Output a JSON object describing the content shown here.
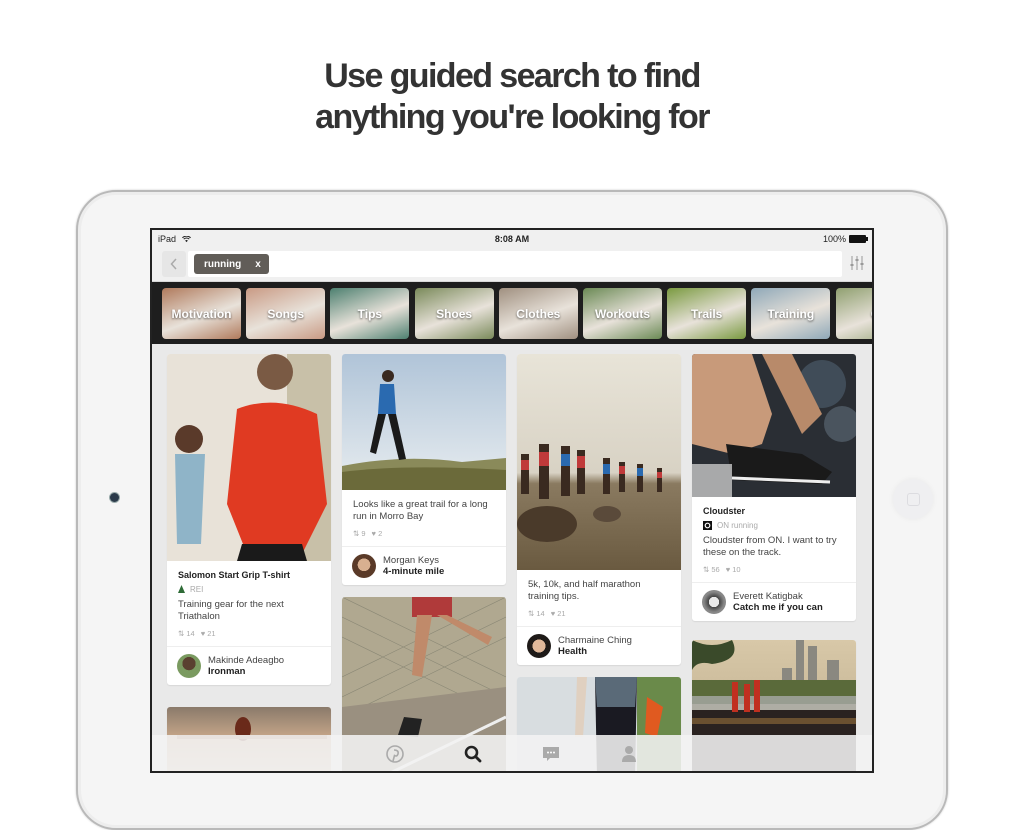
{
  "headline": {
    "line1": "Use guided search to find",
    "line2": "anything you're looking for"
  },
  "device": {
    "status_bar": {
      "device_label": "iPad",
      "wifi_icon": "wifi-icon",
      "time": "8:08 AM",
      "battery_percent": "100%"
    }
  },
  "search": {
    "back_icon": "chevron-left-icon",
    "query_token": "running",
    "clear_token_label": "x",
    "filter_icon": "sliders-icon"
  },
  "guides": [
    {
      "label": "Motivation",
      "color": "#b07a5c"
    },
    {
      "label": "Songs",
      "color": "#c99a84"
    },
    {
      "label": "Tips",
      "color": "#4d8070"
    },
    {
      "label": "Shoes",
      "color": "#7a8a5a"
    },
    {
      "label": "Clothes",
      "color": "#a09080"
    },
    {
      "label": "Workouts",
      "color": "#6b8a55"
    },
    {
      "label": "Trails",
      "color": "#7a9a40"
    },
    {
      "label": "Training",
      "color": "#8fa8b8"
    },
    {
      "label": "C",
      "color": "#90a070"
    }
  ],
  "pins": [
    {
      "title": "Salomon Start Grip T-shirt",
      "source": "REI",
      "source_icon": "tree-icon",
      "description": "Training gear for the next Triathalon",
      "repins": "14",
      "likes": "21",
      "pinner_name": "Makinde Adeagbo",
      "board": "Ironman",
      "photo_color": "#d9d0c4",
      "accent_color": "#e03a22"
    },
    {
      "title": "",
      "source": "",
      "description": "Looks like a great trail for a long run in Morro Bay",
      "repins": "9",
      "likes": "2",
      "pinner_name": "Morgan Keys",
      "board": "4-minute mile",
      "photo_color": "#c8d2dc",
      "accent_color": "#6b7a3a"
    },
    {
      "title": "",
      "source": "",
      "description": "5k, 10k, and half marathon training tips.",
      "repins": "14",
      "likes": "21",
      "pinner_name": "Charmaine Ching",
      "board": "Health",
      "photo_color": "#ddd8cc",
      "accent_color": "#8a6a4a"
    },
    {
      "title": "Cloudster",
      "source": "ON running",
      "source_icon": "on-logo-icon",
      "description": "Cloudster from ON. I want to try these on the track.",
      "repins": "56",
      "likes": "10",
      "pinner_name": "Everett Katigbak",
      "board": "Catch me if you can",
      "photo_color": "#4a5058",
      "accent_color": "#222222"
    },
    {
      "photo_color": "#c9a88a"
    },
    {
      "photo_color": "#9a8a70"
    },
    {
      "photo_color": "#d8dde0"
    },
    {
      "photo_color": "#8aa0b0"
    }
  ],
  "tabbar": [
    {
      "icon": "pinterest-icon",
      "active": false
    },
    {
      "icon": "search-icon",
      "active": true
    },
    {
      "icon": "messages-icon",
      "active": false
    },
    {
      "icon": "profile-icon",
      "active": false
    }
  ]
}
